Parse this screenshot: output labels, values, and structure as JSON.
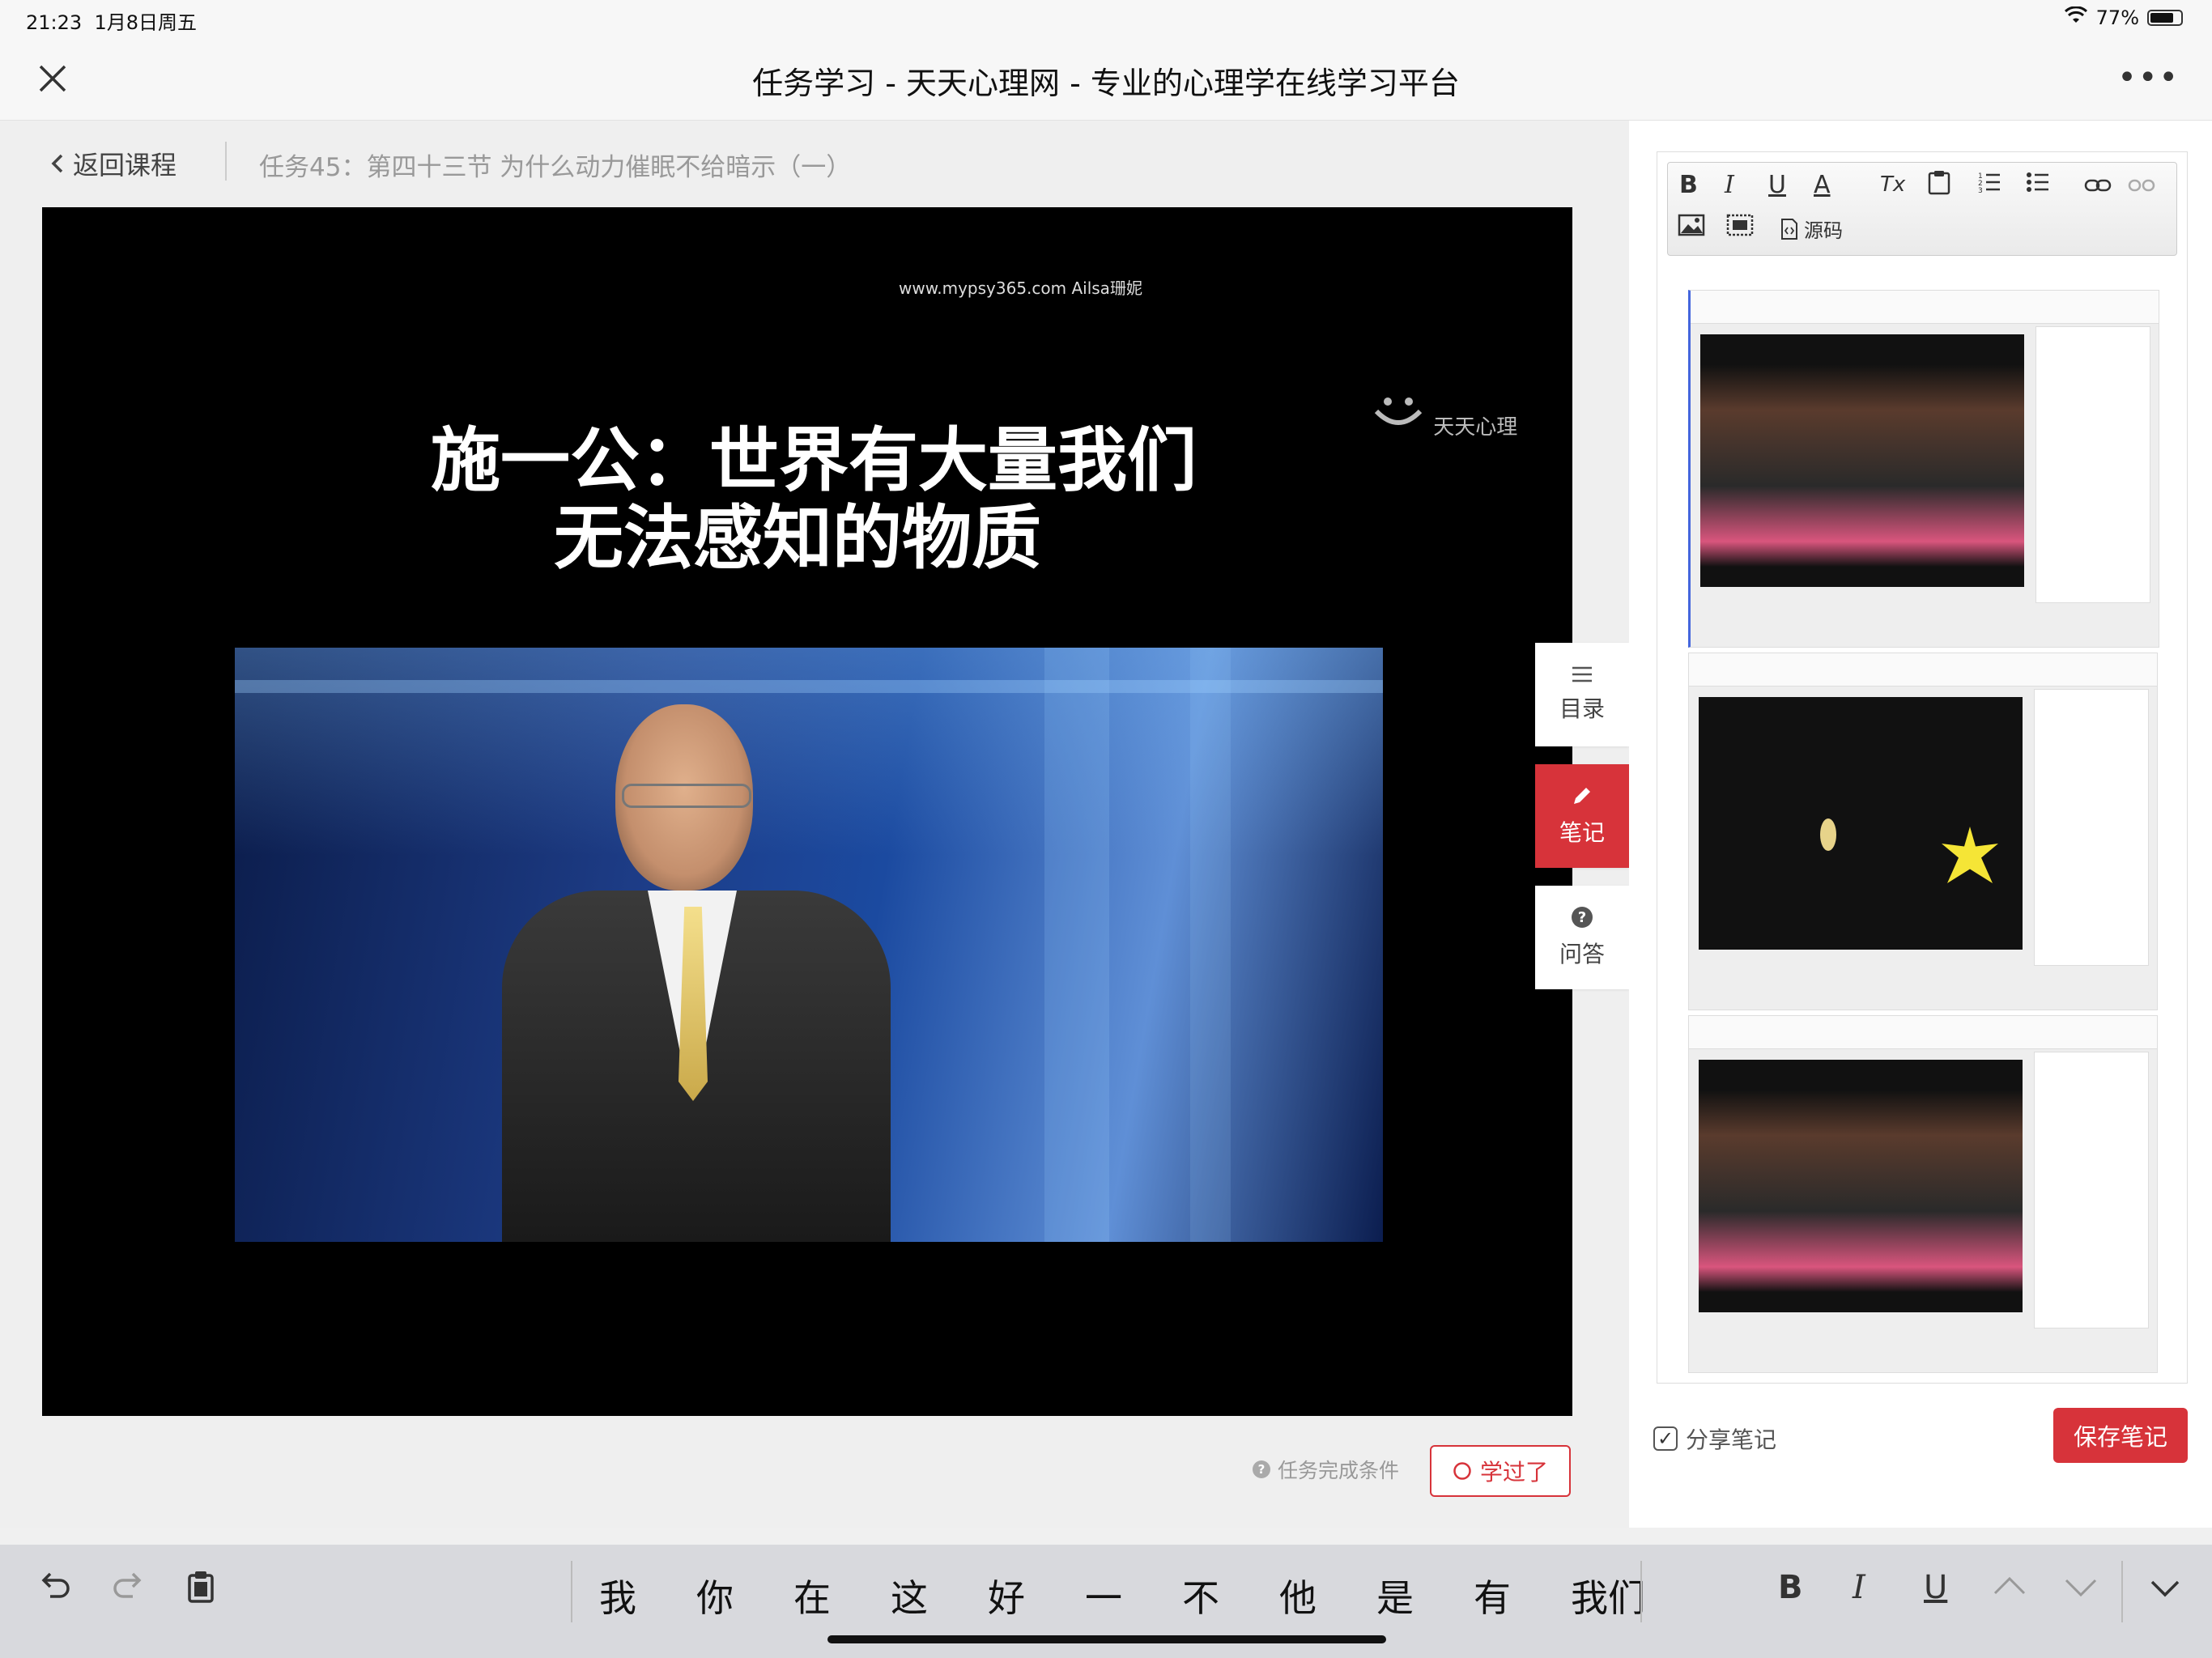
{
  "status_bar": {
    "time": "21:23",
    "date": "1月8日周五",
    "battery": "77%",
    "battery_level": 0.77
  },
  "titlebar": {
    "title": "任务学习 - 天天心理网 - 专业的心理学在线学习平台",
    "more": "•••"
  },
  "header": {
    "back_label": "返回课程",
    "lesson_title": "任务45：第四十三节 为什么动力催眠不给暗示（一）"
  },
  "video": {
    "watermark": "www.mypsy365.com Ailsa珊妮",
    "logo_text": "天天心理",
    "slide_line1": "施一公：世界有大量我们",
    "slide_line2": "无法感知的物质"
  },
  "side_tabs": [
    {
      "label": "目录",
      "icon": "list-icon"
    },
    {
      "label": "笔记",
      "icon": "pencil-icon"
    },
    {
      "label": "问答",
      "icon": "question-icon"
    }
  ],
  "footer_left": {
    "condition": "任务完成条件",
    "learned_button": "学过了"
  },
  "editor": {
    "toolbar": {
      "bold": "B",
      "italic": "I",
      "underline": "U",
      "font_color": "A",
      "clear_format": "Tx",
      "source": "源码"
    }
  },
  "notes_footer": {
    "share_label": "分享笔记",
    "save_button": "保存笔记"
  },
  "keyboard": {
    "candidates": [
      "我",
      "你",
      "在",
      "这",
      "好",
      "一",
      "不",
      "他",
      "是",
      "有",
      "我们"
    ],
    "bold": "B",
    "italic": "I",
    "underline": "U"
  },
  "colors": {
    "accent": "#d7333a"
  }
}
